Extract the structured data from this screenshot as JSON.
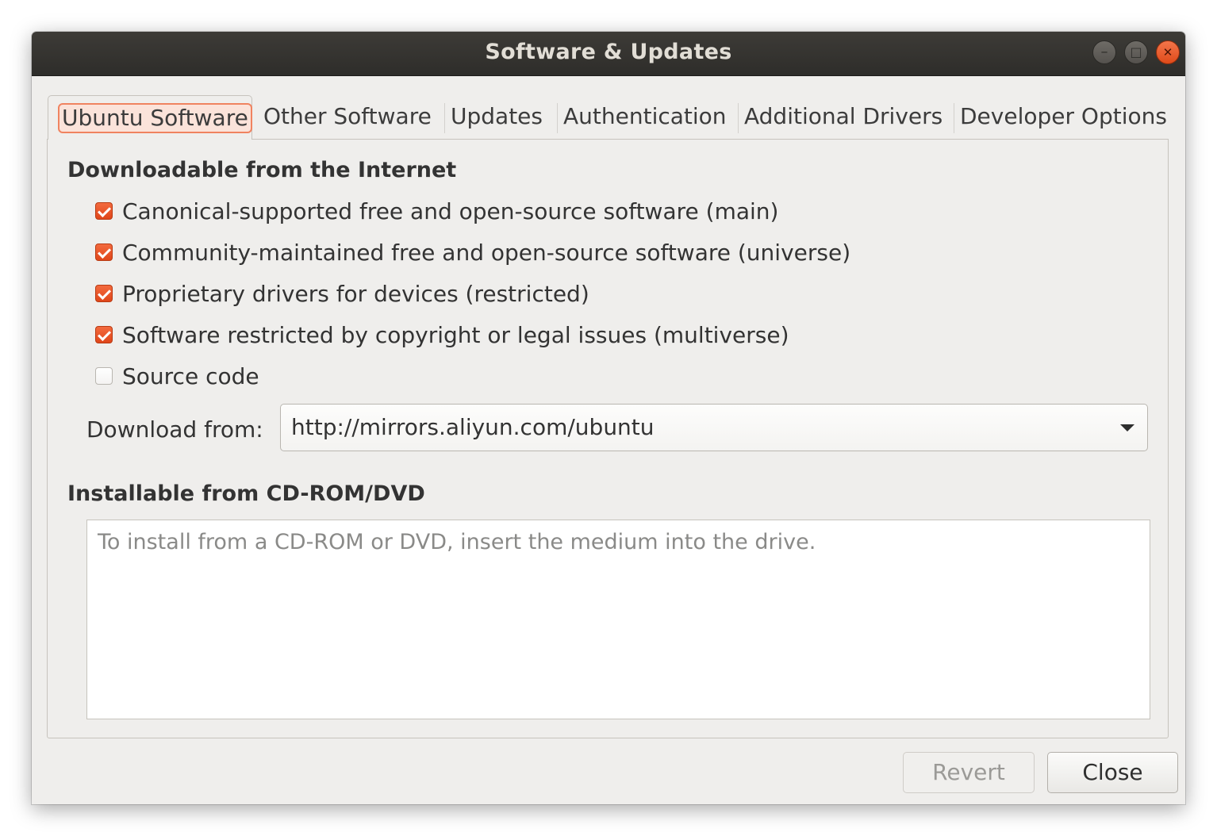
{
  "window": {
    "title": "Software & Updates",
    "controls": {
      "minimize": "–",
      "maximize": "□",
      "close": "✕"
    }
  },
  "tabs": [
    {
      "label": "Ubuntu Software",
      "active": true
    },
    {
      "label": "Other Software",
      "active": false
    },
    {
      "label": "Updates",
      "active": false
    },
    {
      "label": "Authentication",
      "active": false
    },
    {
      "label": "Additional Drivers",
      "active": false
    },
    {
      "label": "Developer Options",
      "active": false
    }
  ],
  "internet": {
    "heading": "Downloadable from the Internet",
    "options": [
      {
        "label": "Canonical-supported free and open-source software (main)",
        "checked": true
      },
      {
        "label": "Community-maintained free and open-source software (universe)",
        "checked": true
      },
      {
        "label": "Proprietary drivers for devices (restricted)",
        "checked": true
      },
      {
        "label": "Software restricted by copyright or legal issues (multiverse)",
        "checked": true
      },
      {
        "label": "Source code",
        "checked": false
      }
    ],
    "download_from_label": "Download from:",
    "download_from_value": "http://mirrors.aliyun.com/ubuntu"
  },
  "cdrom": {
    "heading": "Installable from CD-ROM/DVD",
    "message": "To install from a CD-ROM or DVD, insert the medium into the drive."
  },
  "buttons": {
    "revert": "Revert",
    "close": "Close"
  },
  "colors": {
    "accent": "#e95420",
    "titlebar": "#353431",
    "background": "#efeeec"
  }
}
